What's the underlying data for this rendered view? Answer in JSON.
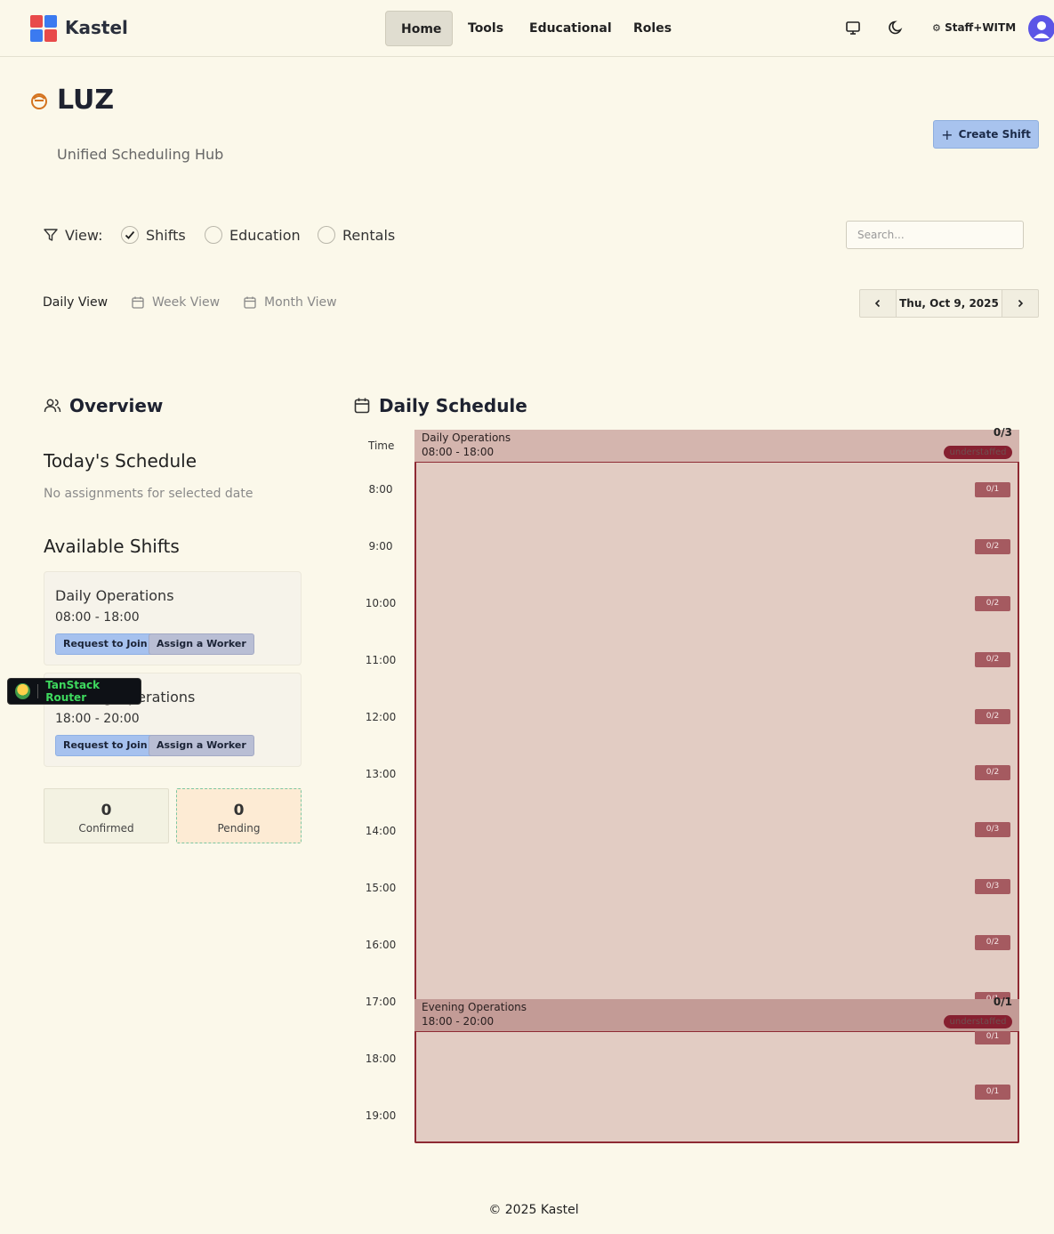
{
  "app": {
    "name": "Kastel"
  },
  "nav": {
    "items": [
      {
        "label": "Home",
        "active": true
      },
      {
        "label": "Tools",
        "active": false
      },
      {
        "label": "Educational",
        "active": false
      },
      {
        "label": "Roles",
        "active": false
      }
    ],
    "user_role": "Staff+WITM"
  },
  "org": {
    "title": "LUZ",
    "subtitle": "Unified Scheduling Hub"
  },
  "actions": {
    "create_shift": "Create Shift"
  },
  "filters": {
    "view_label": "View:",
    "options": [
      {
        "label": "Shifts",
        "checked": true
      },
      {
        "label": "Education",
        "checked": false
      },
      {
        "label": "Rentals",
        "checked": false
      }
    ],
    "search_placeholder": "Search..."
  },
  "view_tabs": [
    {
      "label": "Daily View",
      "active": true
    },
    {
      "label": "Week View",
      "active": false
    },
    {
      "label": "Month View",
      "active": false
    }
  ],
  "date_nav": {
    "current": "Thu, Oct 9, 2025"
  },
  "overview": {
    "title": "Overview",
    "todays_schedule": {
      "heading": "Today's Schedule",
      "empty": "No assignments for selected date"
    },
    "available_shifts": {
      "heading": "Available Shifts",
      "items": [
        {
          "name": "Daily Operations",
          "time": "08:00 - 18:00",
          "join": "Request to Join",
          "assign": "Assign a Worker"
        },
        {
          "name": "Evening Operations",
          "time": "18:00 - 20:00",
          "join": "Request to Join",
          "assign": "Assign a Worker"
        }
      ]
    },
    "stats": [
      {
        "value": "0",
        "label": "Confirmed"
      },
      {
        "value": "0",
        "label": "Pending"
      }
    ]
  },
  "devtools": {
    "label": "TanStack Router"
  },
  "schedule": {
    "title": "Daily Schedule",
    "time_header": "Time",
    "hours": [
      "8:00",
      "9:00",
      "10:00",
      "11:00",
      "12:00",
      "13:00",
      "14:00",
      "15:00",
      "16:00",
      "17:00",
      "18:00",
      "19:00"
    ],
    "slot_counts": [
      "0/1",
      "0/2",
      "0/2",
      "0/2",
      "0/2",
      "0/2",
      "0/3",
      "0/3",
      "0/2",
      "0/1",
      "0/1",
      "0/1"
    ],
    "shifts": [
      {
        "name": "Daily Operations",
        "time": "08:00 - 18:00",
        "count": "0/3",
        "status": "understaffed"
      },
      {
        "name": "Evening Operations",
        "time": "18:00 - 20:00",
        "count": "0/1",
        "status": "understaffed"
      }
    ]
  },
  "footer": {
    "text": "© 2025 Kastel"
  },
  "colors": {
    "background": "#fbf8ea",
    "understaffed": "#862030",
    "primary_button": "#a8c3ee"
  }
}
